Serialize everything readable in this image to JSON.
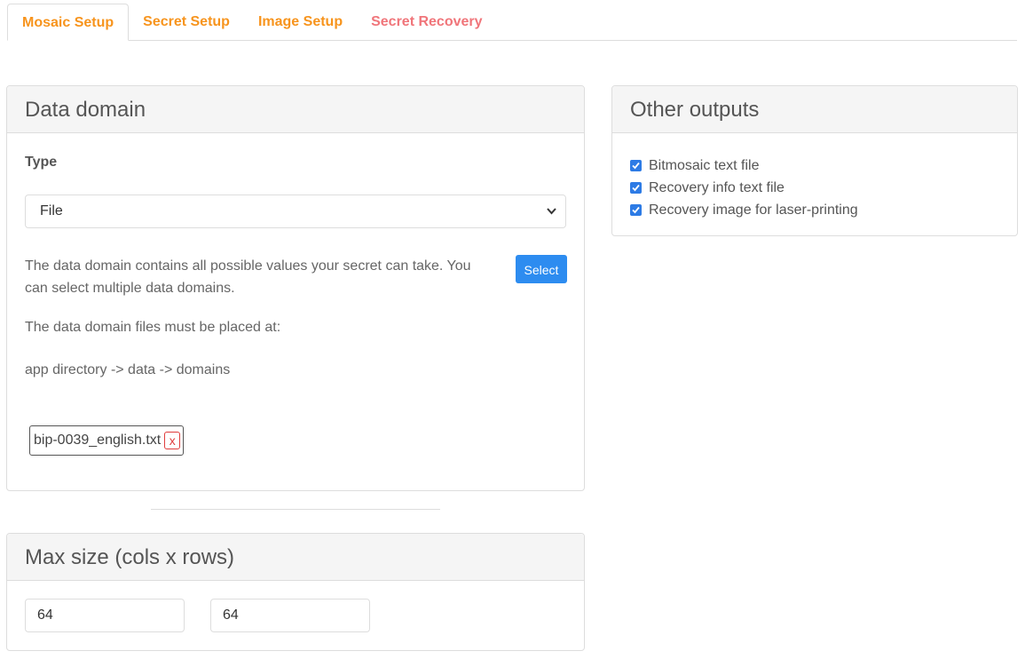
{
  "tabs": [
    {
      "label": "Mosaic Setup",
      "active": true
    },
    {
      "label": "Secret Setup"
    },
    {
      "label": "Image Setup"
    },
    {
      "label": "Secret Recovery"
    }
  ],
  "data_domain": {
    "title": "Data domain",
    "type_label": "Type",
    "type_value": "File",
    "description": "The data domain contains all possible values your secret can take. You can select multiple data domains.",
    "select_button": "Select",
    "location_text": "The data domain files must be placed at:",
    "path_text": "app directory -> data -> domains",
    "files": [
      {
        "name": "bip-0039_english.txt",
        "remove_label": "x"
      }
    ]
  },
  "other_outputs": {
    "title": "Other outputs",
    "options": [
      {
        "label": "Bitmosaic text file",
        "checked": true
      },
      {
        "label": "Recovery info text file",
        "checked": true
      },
      {
        "label": "Recovery image for laser-printing",
        "checked": true
      }
    ]
  },
  "max_size": {
    "title": "Max size (cols x rows)",
    "cols": "64",
    "rows": "64"
  },
  "colors": {
    "tab_orange": "#f7941d",
    "tab_recovery": "#f0757a",
    "primary_blue": "#2d8cf0",
    "danger_red": "#e03c3c"
  },
  "icons": {
    "select_chevron": "chevron-down-icon",
    "checkbox_mark": "checkmark-icon"
  }
}
